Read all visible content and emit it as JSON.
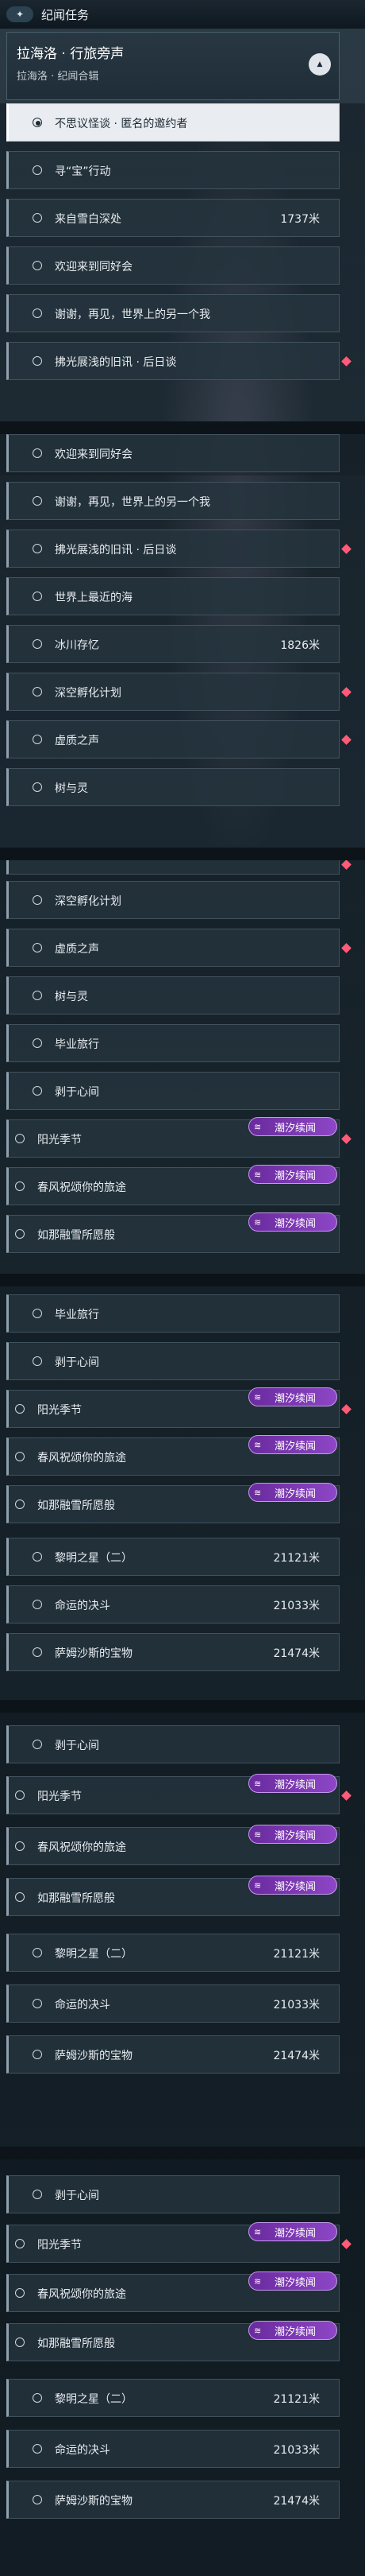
{
  "header": {
    "badge_icon": "plus-star-icon",
    "title": "纪闻任务",
    "subtitle": ""
  },
  "subhead": {
    "title": "拉海洛 · 行旅旁声",
    "subtitle": "拉海洛 · 纪闻合辑",
    "collapse_icon": "chevron-up-icon"
  },
  "tag_label": "潮汐续闻",
  "quests": {
    "q1": "不思议怪谈 · 匿名的邀约者",
    "q2": "寻“宝”行动",
    "q3": "来自雪白深处",
    "q4": "欢迎来到同好会",
    "q5": "谢谢，再见，世界上的另一个我",
    "q6": "拂光展浅的旧讯 · 后日谈",
    "q7": "世界上最近的海",
    "q8": "冰川存忆",
    "q9": "深空孵化计划",
    "q10": "虚质之声",
    "q11": "树与灵",
    "q12": "毕业旅行",
    "q13": "剥于心间",
    "q14": "阳光季节",
    "q15": "春风祝颂你的旅途",
    "q16": "如那融雪所愿般",
    "q17": "黎明之星（二）",
    "q18": "命运的决斗",
    "q19": "萨姆沙斯的宝物"
  },
  "distances": {
    "d_q3": "1737米",
    "d_q8": "1826米",
    "d_q17": "21121米",
    "d_q18": "21033米",
    "d_q19": "21474米"
  },
  "colors": {
    "accent_pink": "#ff5b78",
    "tag_purple": "#7a38b4",
    "selected_bg": "#e9edf1"
  }
}
